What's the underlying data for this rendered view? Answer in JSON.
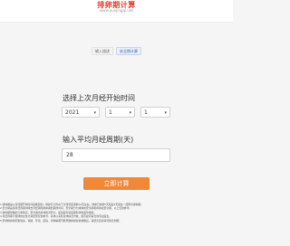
{
  "header": {
    "logo_title": "排卵期计算",
    "logo_sub": "www.yuejingqi.net"
  },
  "tabs": [
    {
      "label": "输入描述"
    },
    {
      "label": "安全期计算",
      "active": true
    }
  ],
  "form": {
    "last_period_label": "选择上次月经开始时间",
    "year": "2021",
    "month": "1",
    "day": "1",
    "cycle_label": "输入平均月经周期(天)",
    "cycle_value": "28",
    "submit_label": "立即计算"
  },
  "notes": [
    "1.排卵期是从月经期开始时间起推算的，排卵日大约在下次月经来潮前14天左右，排卵日的前5天和后4天加在一起称为排卵期。",
    "2.安全期是指月经周期中除去月经期和排卵期的其他时间，安全期分为排卵前安全期和排卵后安全期，以上仅供参考。",
    "3.排卵期受精的几率较高，安全期也并非绝对安全，如需避孕请采取科学的避孕措施。",
    "4.月经周期不规律的女性计算结果仅供参考，具体以实际身体情况为准，如有疑问请咨询专业医生。",
    "5.影响排卵的因素较多，情绪、环境、疾病、药物等都可能导致排卵提前或推后，请结合自身情况综合判断。"
  ],
  "colors": {
    "brand": "#e23a2c",
    "button": "#f0883a",
    "tab_active": "#4a6fb0"
  }
}
